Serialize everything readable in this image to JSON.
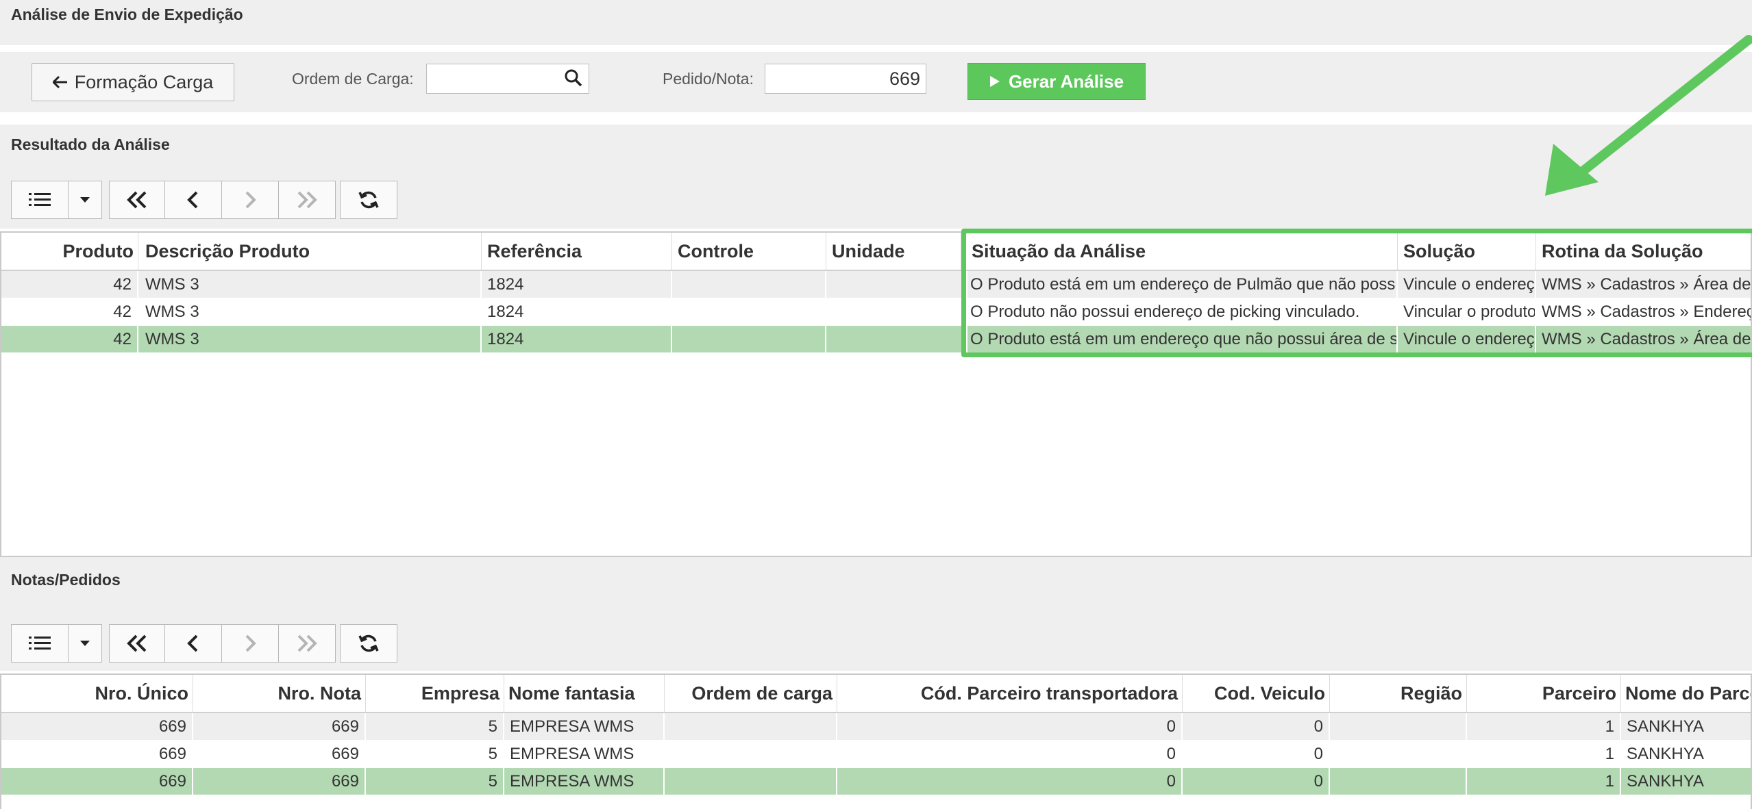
{
  "page": {
    "title": "Análise de Envio de Expedição"
  },
  "form": {
    "formacao_carga_label": "Formação Carga",
    "ordem_label": "Ordem de Carga:",
    "ordem_value": "",
    "pedido_label": "Pedido/Nota:",
    "pedido_value": "669",
    "gerar_label": "Gerar Análise"
  },
  "analysis": {
    "section_title": "Resultado da Análise",
    "columns": [
      "Produto",
      "Descrição Produto",
      "Referência",
      "Controle",
      "Unidade",
      "Situação da Análise",
      "Solução",
      "Rotina da Solução"
    ],
    "rows": [
      [
        "42",
        "WMS 3",
        "1824",
        "",
        "",
        "O Produto está em um endereço de Pulmão que não possui",
        "Vincule o endereço",
        "WMS » Cadastros » Área de"
      ],
      [
        "42",
        "WMS 3",
        "1824",
        "",
        "",
        "O Produto não possui endereço de picking vinculado.",
        "Vincular o produto",
        "WMS » Cadastros » Endereço"
      ],
      [
        "42",
        "WMS 3",
        "1824",
        "",
        "",
        "O Produto está em um endereço que não possui área de s",
        "Vincule o endereço",
        "WMS » Cadastros » Área de"
      ]
    ]
  },
  "orders": {
    "section_title": "Notas/Pedidos",
    "columns": [
      "Nro. Único",
      "Nro. Nota",
      "Empresa",
      "Nome fantasia",
      "Ordem de carga",
      "Cód. Parceiro transportadora",
      "Cod. Veiculo",
      "Região",
      "Parceiro",
      "Nome do Parceiro"
    ],
    "rows": [
      [
        "669",
        "669",
        "5",
        "EMPRESA WMS",
        "",
        "0",
        "0",
        "",
        "1",
        "SANKHYA"
      ],
      [
        "669",
        "669",
        "5",
        "EMPRESA WMS",
        "",
        "0",
        "0",
        "",
        "1",
        "SANKHYA"
      ],
      [
        "669",
        "669",
        "5",
        "EMPRESA WMS",
        "",
        "0",
        "0",
        "",
        "1",
        "SANKHYA"
      ]
    ]
  },
  "icons": [
    "arrow-left-icon",
    "search-icon",
    "play-icon",
    "list-icon",
    "caret-down-icon",
    "first-page-icon",
    "previous-page-icon",
    "next-page-icon",
    "last-page-icon",
    "refresh-icon",
    "annotation-arrow-icon"
  ],
  "colors": {
    "accent_green": "#5cc85c",
    "selected_row": "#b3d9b3",
    "highlight_border": "#5ec85e"
  }
}
